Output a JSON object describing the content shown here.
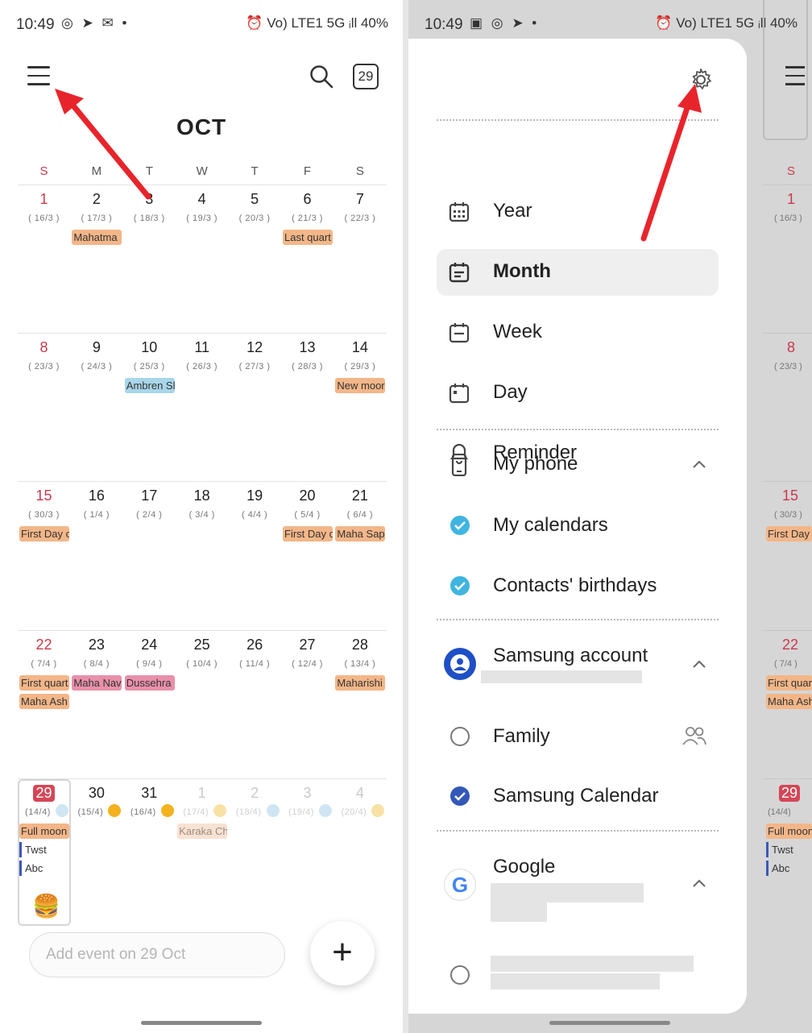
{
  "left": {
    "status": {
      "time": "10:49",
      "icons_left": "◎ ➤ ✉ •",
      "icons_right": "⏰ Vo) LTE1 5G ᵢll 40%"
    },
    "today_badge": "29",
    "month": "OCT",
    "weekdays": [
      "S",
      "M",
      "T",
      "W",
      "T",
      "F",
      "S"
    ],
    "weeks": [
      [
        {
          "d": "1",
          "l": "( 16/3 )",
          "sun": true
        },
        {
          "d": "2",
          "l": "( 17/3 )",
          "events": [
            {
              "t": "Mahatma",
              "c": "orange"
            }
          ]
        },
        {
          "d": "3",
          "l": "( 18/3 )"
        },
        {
          "d": "4",
          "l": "( 19/3 )"
        },
        {
          "d": "5",
          "l": "( 20/3 )"
        },
        {
          "d": "6",
          "l": "( 21/3 )",
          "events": [
            {
              "t": "Last quart",
              "c": "orange"
            }
          ]
        },
        {
          "d": "7",
          "l": "( 22/3 )"
        }
      ],
      [
        {
          "d": "8",
          "l": "( 23/3 )",
          "sun": true
        },
        {
          "d": "9",
          "l": "( 24/3 )"
        },
        {
          "d": "10",
          "l": "( 25/3 )",
          "events": [
            {
              "t": "Ambren Sl",
              "c": "blue"
            }
          ]
        },
        {
          "d": "11",
          "l": "( 26/3 )"
        },
        {
          "d": "12",
          "l": "( 27/3 )"
        },
        {
          "d": "13",
          "l": "( 28/3 )"
        },
        {
          "d": "14",
          "l": "( 29/3 )",
          "events": [
            {
              "t": "New moor",
              "c": "orange"
            }
          ]
        }
      ],
      [
        {
          "d": "15",
          "l": "( 30/3 )",
          "sun": true,
          "events": [
            {
              "t": "First Day o",
              "c": "orange"
            }
          ]
        },
        {
          "d": "16",
          "l": "( 1/4 )"
        },
        {
          "d": "17",
          "l": "( 2/4 )"
        },
        {
          "d": "18",
          "l": "( 3/4 )"
        },
        {
          "d": "19",
          "l": "( 4/4 )"
        },
        {
          "d": "20",
          "l": "( 5/4 )",
          "events": [
            {
              "t": "First Day o",
              "c": "orange"
            }
          ]
        },
        {
          "d": "21",
          "l": "( 6/4 )",
          "events": [
            {
              "t": "Maha Sap",
              "c": "orange"
            }
          ]
        }
      ],
      [
        {
          "d": "22",
          "l": "( 7/4 )",
          "sun": true,
          "events": [
            {
              "t": "First quart",
              "c": "orange"
            },
            {
              "t": "Maha Ash",
              "c": "orange"
            }
          ]
        },
        {
          "d": "23",
          "l": "( 8/4 )",
          "events": [
            {
              "t": "Maha Nav",
              "c": "pink"
            }
          ]
        },
        {
          "d": "24",
          "l": "( 9/4 )",
          "events": [
            {
              "t": "Dussehra",
              "c": "pink"
            }
          ]
        },
        {
          "d": "25",
          "l": "( 10/4 )"
        },
        {
          "d": "26",
          "l": "( 11/4 )"
        },
        {
          "d": "27",
          "l": "( 12/4 )"
        },
        {
          "d": "28",
          "l": "( 13/4 )",
          "events": [
            {
              "t": "Maharishi",
              "c": "orange"
            }
          ]
        }
      ],
      [
        {
          "d": "29",
          "l": "(14/4)",
          "today": true,
          "w": "cloud",
          "events": [
            {
              "t": "Full moon",
              "c": "orange"
            },
            {
              "t": "Twst",
              "c": "task"
            },
            {
              "t": "Abc",
              "c": "task"
            }
          ]
        },
        {
          "d": "30",
          "l": "(15/4)",
          "w": "sun"
        },
        {
          "d": "31",
          "l": "(16/4)",
          "w": "sun"
        },
        {
          "d": "1",
          "l": "(17/4)",
          "other": true,
          "w": "sun-faded",
          "events": [
            {
              "t": "Karaka Ch",
              "c": "faded"
            }
          ]
        },
        {
          "d": "2",
          "l": "(18/4)",
          "other": true,
          "w": "cloud"
        },
        {
          "d": "3",
          "l": "(19/4)",
          "other": true,
          "w": "cloud"
        },
        {
          "d": "4",
          "l": "(20/4)",
          "other": true,
          "w": "sun-faded"
        }
      ]
    ],
    "burger_emoji": "🍔",
    "add_event_placeholder": "Add event on 29 Oct",
    "fab_label": "+"
  },
  "right": {
    "status": {
      "time": "10:49",
      "icons_left": "▣ ◎ ➤ •",
      "icons_right": "⏰ Vo) LTE1 5G ᵢll 40%"
    },
    "views": [
      {
        "label": "Year",
        "icon": "calendar-grid-icon"
      },
      {
        "label": "Month",
        "icon": "calendar-month-icon",
        "active": true
      },
      {
        "label": "Week",
        "icon": "calendar-week-icon"
      },
      {
        "label": "Day",
        "icon": "calendar-day-icon"
      },
      {
        "label": "Reminder",
        "icon": "bell-icon"
      }
    ],
    "my_phone": "My phone",
    "my_calendars": "My calendars",
    "contacts_birthdays": "Contacts' birthdays",
    "samsung_account": "Samsung account",
    "family": "Family",
    "samsung_calendar": "Samsung Calendar",
    "google": "Google",
    "bg_weekday": "S",
    "bg_days": [
      {
        "d": "1",
        "l": "( 16/3 )"
      },
      {
        "d": "8",
        "l": "( 23/3 )"
      },
      {
        "d": "15",
        "l": "( 30/3 )",
        "e": "First Day"
      },
      {
        "d": "22",
        "l": "( 7/4 )",
        "e": "First quar",
        "e2": "Maha Ash"
      },
      {
        "d": "29",
        "l": "(14/4)",
        "e": "Full moon",
        "t1": "Twst",
        "t2": "Abc"
      }
    ]
  },
  "colors": {
    "sunday_red": "#c93a4c",
    "today_red": "#d54657",
    "event_orange": "#f3b688",
    "event_pink": "#e890aa",
    "event_blue": "#a9d6ea",
    "check_cyan": "#3fb5e0",
    "check_navy": "#3358b8"
  }
}
